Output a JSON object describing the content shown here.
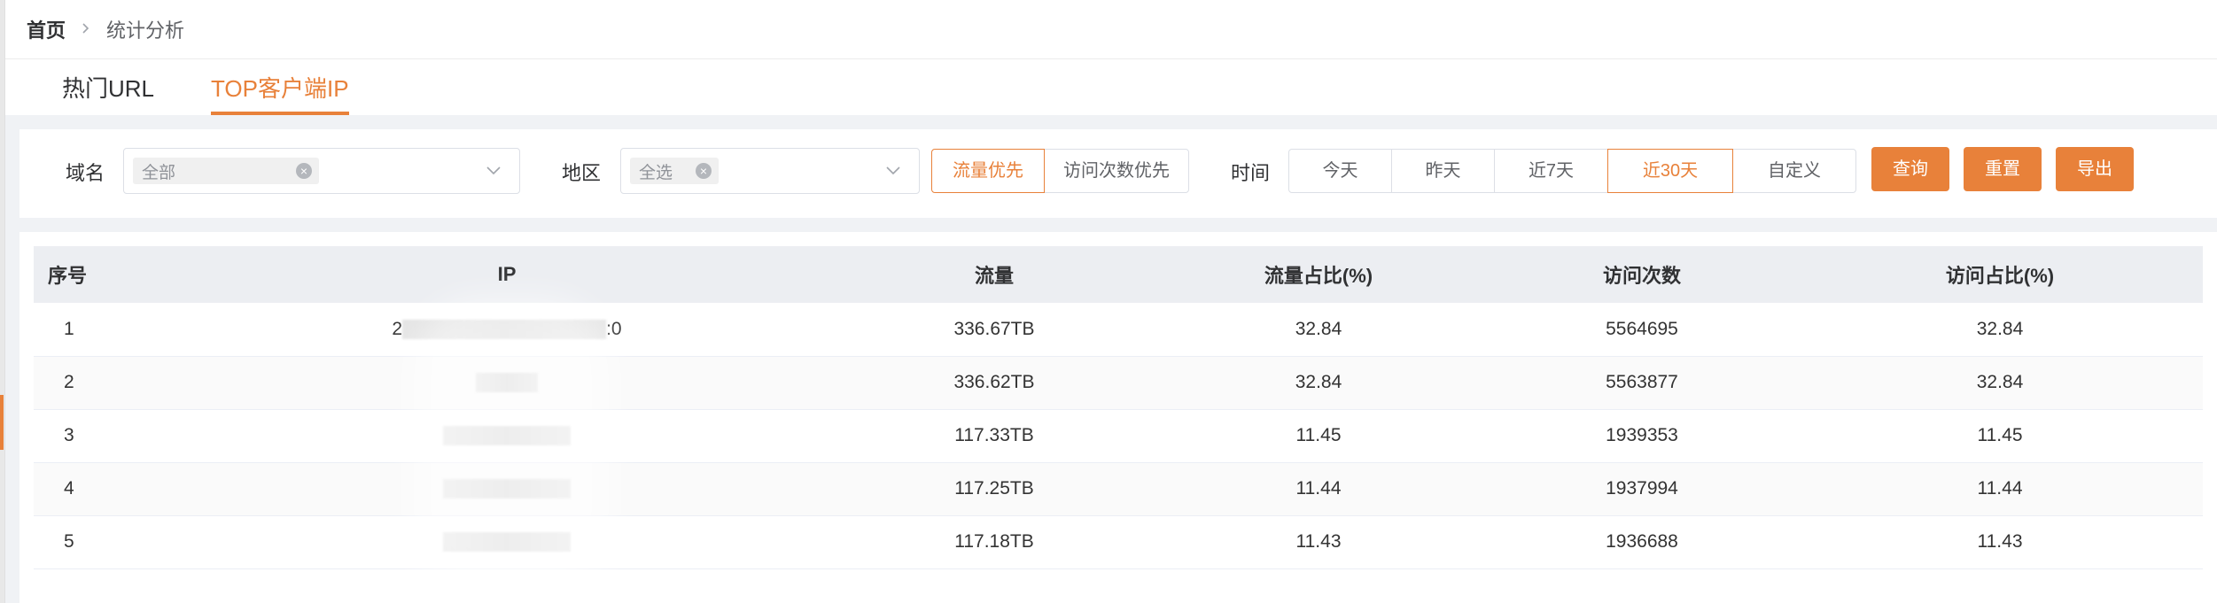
{
  "breadcrumb": {
    "home": "首页",
    "current": "统计分析"
  },
  "tabs": [
    {
      "label": "热门URL",
      "active": false
    },
    {
      "label": "TOP客户端IP",
      "active": true
    }
  ],
  "filters": {
    "domain_label": "域名",
    "domain_tag": "全部",
    "region_label": "地区",
    "region_tag": "全选",
    "sort_options": [
      {
        "label": "流量优先",
        "active": true
      },
      {
        "label": "访问次数优先",
        "active": false
      }
    ],
    "time_label": "时间",
    "time_options": [
      {
        "label": "今天",
        "active": false
      },
      {
        "label": "昨天",
        "active": false
      },
      {
        "label": "近7天",
        "active": false
      },
      {
        "label": "近30天",
        "active": true
      },
      {
        "label": "自定义",
        "active": false
      }
    ],
    "buttons": {
      "query": "查询",
      "reset": "重置",
      "export": "导出"
    }
  },
  "table": {
    "columns": [
      "序号",
      "IP",
      "流量",
      "流量占比(%)",
      "访问次数",
      "访问占比(%)"
    ],
    "rows": [
      {
        "index": "1",
        "ip_prefix": "2",
        "ip_suffix": ":0",
        "traffic": "336.67TB",
        "traffic_pct": "32.84",
        "visits": "5564695",
        "visit_pct": "32.84"
      },
      {
        "index": "2",
        "ip_prefix": "",
        "ip_suffix": "",
        "traffic": "336.62TB",
        "traffic_pct": "32.84",
        "visits": "5563877",
        "visit_pct": "32.84"
      },
      {
        "index": "3",
        "ip_prefix": "",
        "ip_suffix": "",
        "traffic": "117.33TB",
        "traffic_pct": "11.45",
        "visits": "1939353",
        "visit_pct": "11.45"
      },
      {
        "index": "4",
        "ip_prefix": "",
        "ip_suffix": "",
        "traffic": "117.25TB",
        "traffic_pct": "11.44",
        "visits": "1937994",
        "visit_pct": "11.44"
      },
      {
        "index": "5",
        "ip_prefix": "",
        "ip_suffix": "",
        "traffic": "117.18TB",
        "traffic_pct": "11.43",
        "visits": "1936688",
        "visit_pct": "11.43"
      }
    ]
  },
  "colors": {
    "accent": "#e8813a",
    "header_bg": "#eceef2",
    "page_bg": "#f0f2f5"
  },
  "icons": {
    "breadcrumb_separator": "chevron-right-icon",
    "select_arrow": "chevron-down-icon",
    "tag_close": "close-circle-icon"
  }
}
